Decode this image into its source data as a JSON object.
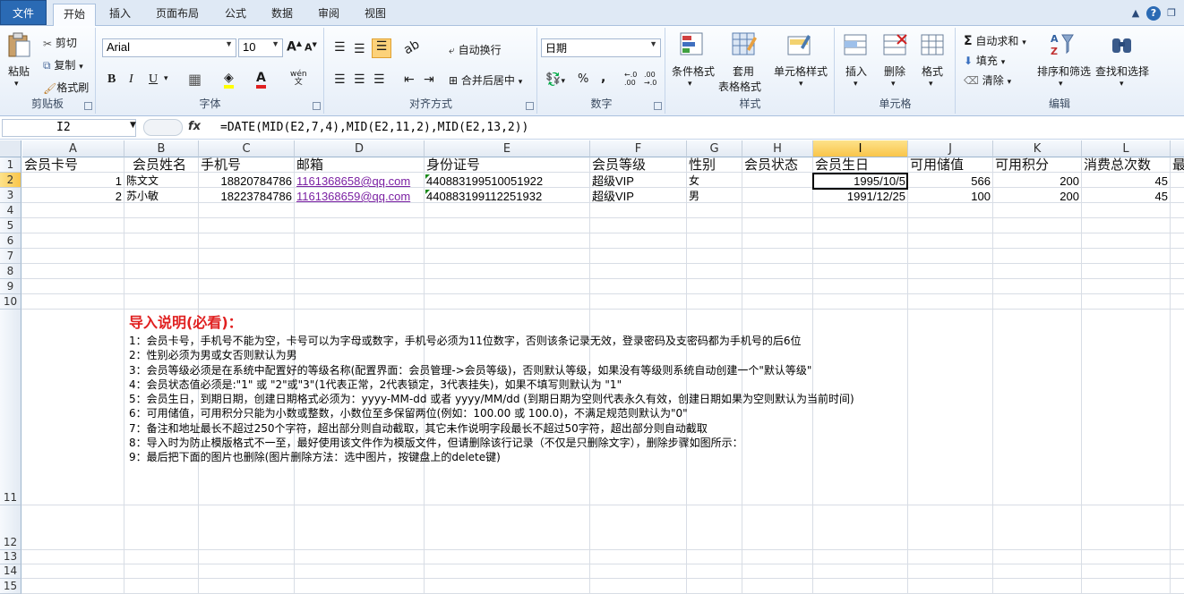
{
  "tabs": {
    "file": "文件",
    "home": "开始",
    "insert": "插入",
    "layout": "页面布局",
    "formulas": "公式",
    "data": "数据",
    "review": "审阅",
    "view": "视图"
  },
  "ribbon": {
    "clipboard": {
      "group": "剪贴板",
      "paste": "粘贴",
      "cut": "剪切",
      "copy": "复制",
      "painter": "格式刷"
    },
    "font": {
      "group": "字体",
      "name": "Arial",
      "size": "10",
      "bold": "B",
      "italic": "I",
      "underline": "U",
      "grow": "A",
      "shrink": "A",
      "wen": "wén"
    },
    "align": {
      "group": "对齐方式",
      "wrap": "自动换行",
      "merge": "合并后居中"
    },
    "number": {
      "group": "数字",
      "format": "日期",
      "percent": "%",
      "comma": ","
    },
    "styles": {
      "group": "样式",
      "cond": "条件格式",
      "table1": "套用",
      "table2": "表格格式",
      "cell": "单元格样式"
    },
    "cells": {
      "group": "单元格",
      "insert": "插入",
      "delete": "删除",
      "format": "格式"
    },
    "editing": {
      "group": "编辑",
      "autosum": "自动求和",
      "fill": "填充",
      "clear": "清除",
      "sort": "排序和筛选",
      "find": "查找和选择"
    }
  },
  "formula_bar": {
    "name_box": "I2",
    "fx": "fx",
    "formula": "=DATE(MID(E2,7,4),MID(E2,11,2),MID(E2,13,2))"
  },
  "columns": [
    "A",
    "B",
    "C",
    "D",
    "E",
    "F",
    "G",
    "H",
    "I",
    "J",
    "K",
    "L"
  ],
  "rows": [
    "1",
    "2",
    "3",
    "4",
    "5",
    "6",
    "7",
    "8",
    "9",
    "10",
    "11",
    "12",
    "13",
    "14",
    "15"
  ],
  "headers": [
    "会员卡号",
    "会员姓名",
    "手机号",
    "邮箱",
    "身份证号",
    "会员等级",
    "性别",
    "会员状态",
    "会员生日",
    "可用储值",
    "可用积分",
    "消费总次数",
    "最"
  ],
  "data_rows": [
    {
      "a": "1",
      "b": "陈文文",
      "c": "18820784786",
      "d": "1161368658@qq.com",
      "e": "440883199510051922",
      "f": "超级VIP",
      "g": "女",
      "h": "",
      "i": "1995/10/5",
      "j": "566",
      "k": "200",
      "l": "45"
    },
    {
      "a": "2",
      "b": "苏小敏",
      "c": "18223784786",
      "d": "1161368659@qq.com",
      "e": "440883199112251932",
      "f": "超级VIP",
      "g": "男",
      "h": "",
      "i": "1991/12/25",
      "j": "100",
      "k": "200",
      "l": "45"
    }
  ],
  "notes": {
    "title": "导入说明(必看)：",
    "lines": [
      "1：会员卡号，手机号不能为空，卡号可以为字母或数字，手机号必须为11位数字，否则该条记录无效，登录密码及支密码都为手机号的后6位",
      "2：性别必须为男或女否则默认为男",
      "3：会员等级必须是在系统中配置好的等级名称(配置界面：会员管理->会员等级)，否则默认等级，如果没有等级则系统自动创建一个\"默认等级\"",
      "4：会员状态值必须是:\"1\" 或 \"2\"或\"3\"(1代表正常，2代表锁定，3代表挂失)，如果不填写则默认为 \"1\"",
      "5：会员生日，到期日期，创建日期格式必须为：yyyy-MM-dd 或者 yyyy/MM/dd (到期日期为空则代表永久有效，创建日期如果为空则默认为当前时间)",
      "6：可用储值，可用积分只能为小数或整数，小数位至多保留两位(例如：100.00 或 100.0)，不满足规范则默认为\"0\"",
      "7：备注和地址最长不超过250个字符，超出部分则自动截取，其它未作说明字段最长不超过50字符，超出部分则自动截取",
      "8：导入时为防止模版格式不一至，最好使用该文件作为模版文件，但请删除该行记录（不仅是只删除文字），删除步骤如图所示：",
      "9：最后把下面的图片也删除(图片删除方法：选中图片，按键盘上的delete键)"
    ]
  }
}
